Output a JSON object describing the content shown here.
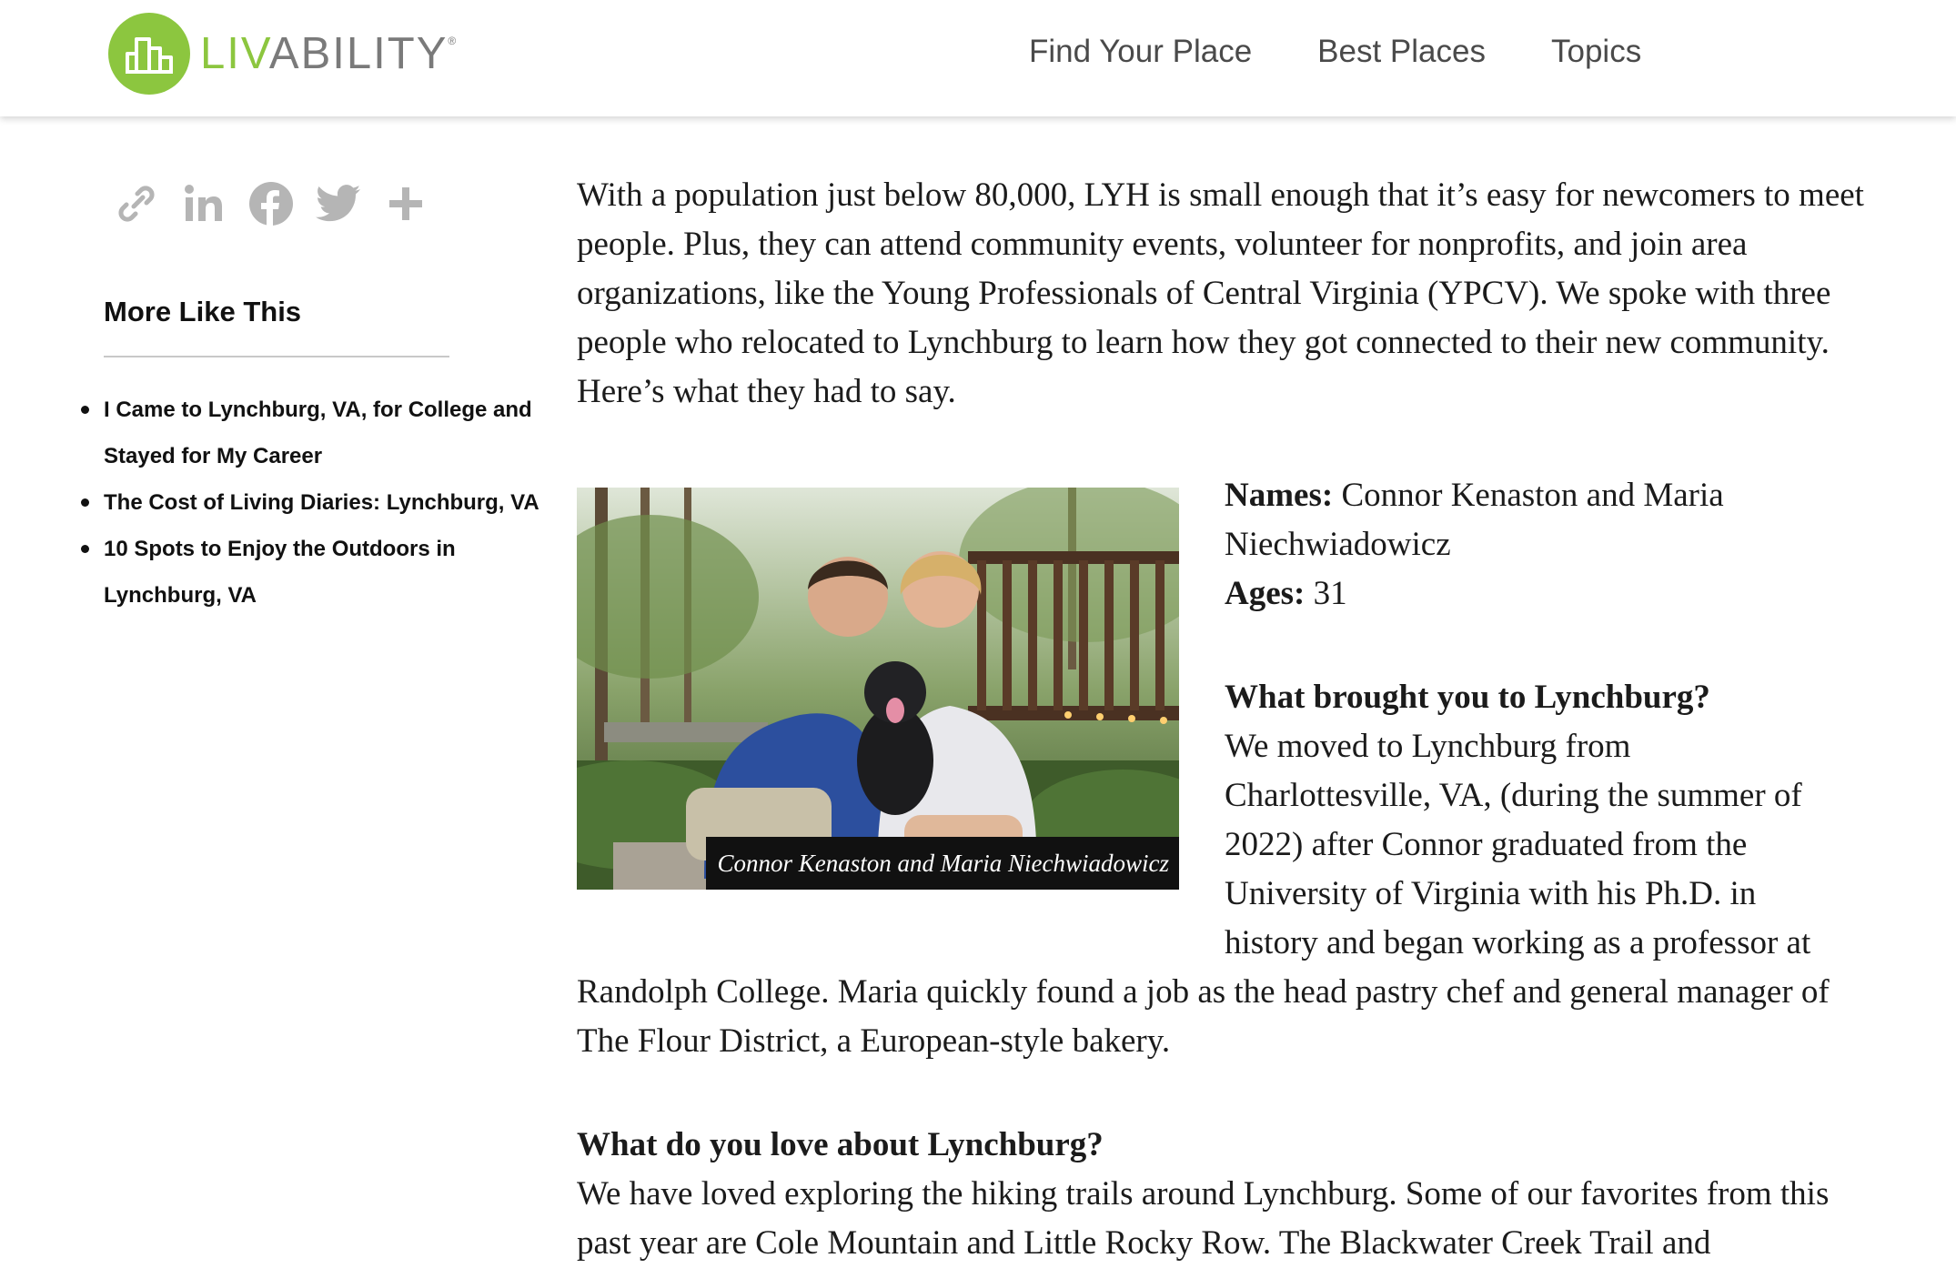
{
  "header": {
    "logo": {
      "part1": "LIV",
      "part2": "ABILITY",
      "mark": "®"
    },
    "nav": [
      "Find Your Place",
      "Best Places",
      "Topics"
    ]
  },
  "share": {
    "icons": [
      "link-icon",
      "linkedin-icon",
      "facebook-icon",
      "twitter-icon",
      "plus-icon"
    ]
  },
  "sidebar": {
    "heading": "More Like This",
    "related": [
      "I Came to Lynchburg, VA, for College and Stayed for My Career",
      "The Cost of Living Diaries: Lynchburg, VA",
      "10 Spots to Enjoy the Outdoors in Lynchburg, VA"
    ]
  },
  "article": {
    "intro": "With a population just below 80,000, LYH is small enough that it’s easy for newcomers to meet people. Plus, they can attend community events, volunteer for nonprofits, and join area organizations, like the Young Professionals of Central Virginia (YPCV). We spoke with three people who relocated to Lynchburg to learn how they got connected to their new community. Here’s what they had to say.",
    "photo_caption": "Connor Kenaston and Maria Niechwiadowicz",
    "names_label": "Names:",
    "names_value": "Connor Kenaston and Maria Niechwiadowicz",
    "ages_label": "Ages:",
    "ages_value": "31",
    "q1": "What brought you to Lynchburg?",
    "a1": "We moved to Lynchburg from Charlottesville, VA, (during the summer of 2022) after Connor graduated from the University of Virginia with his Ph.D. in history and began working as a professor at Randolph College. Maria quickly found a job as the head pastry chef and general manager of The Flour District, a European-style bakery.",
    "q2": "What do you love about Lynchburg?",
    "a2": "We have loved exploring the hiking trails around Lynchburg. Some of our favorites from this past year are Cole Mountain and Little Rocky Row. The Blackwater Creek Trail and"
  },
  "colors": {
    "brand_green": "#8cc63f",
    "logo_gray": "#7a7a7a",
    "nav_text": "#4a4a4a",
    "share_icon": "#b5b5b5"
  }
}
